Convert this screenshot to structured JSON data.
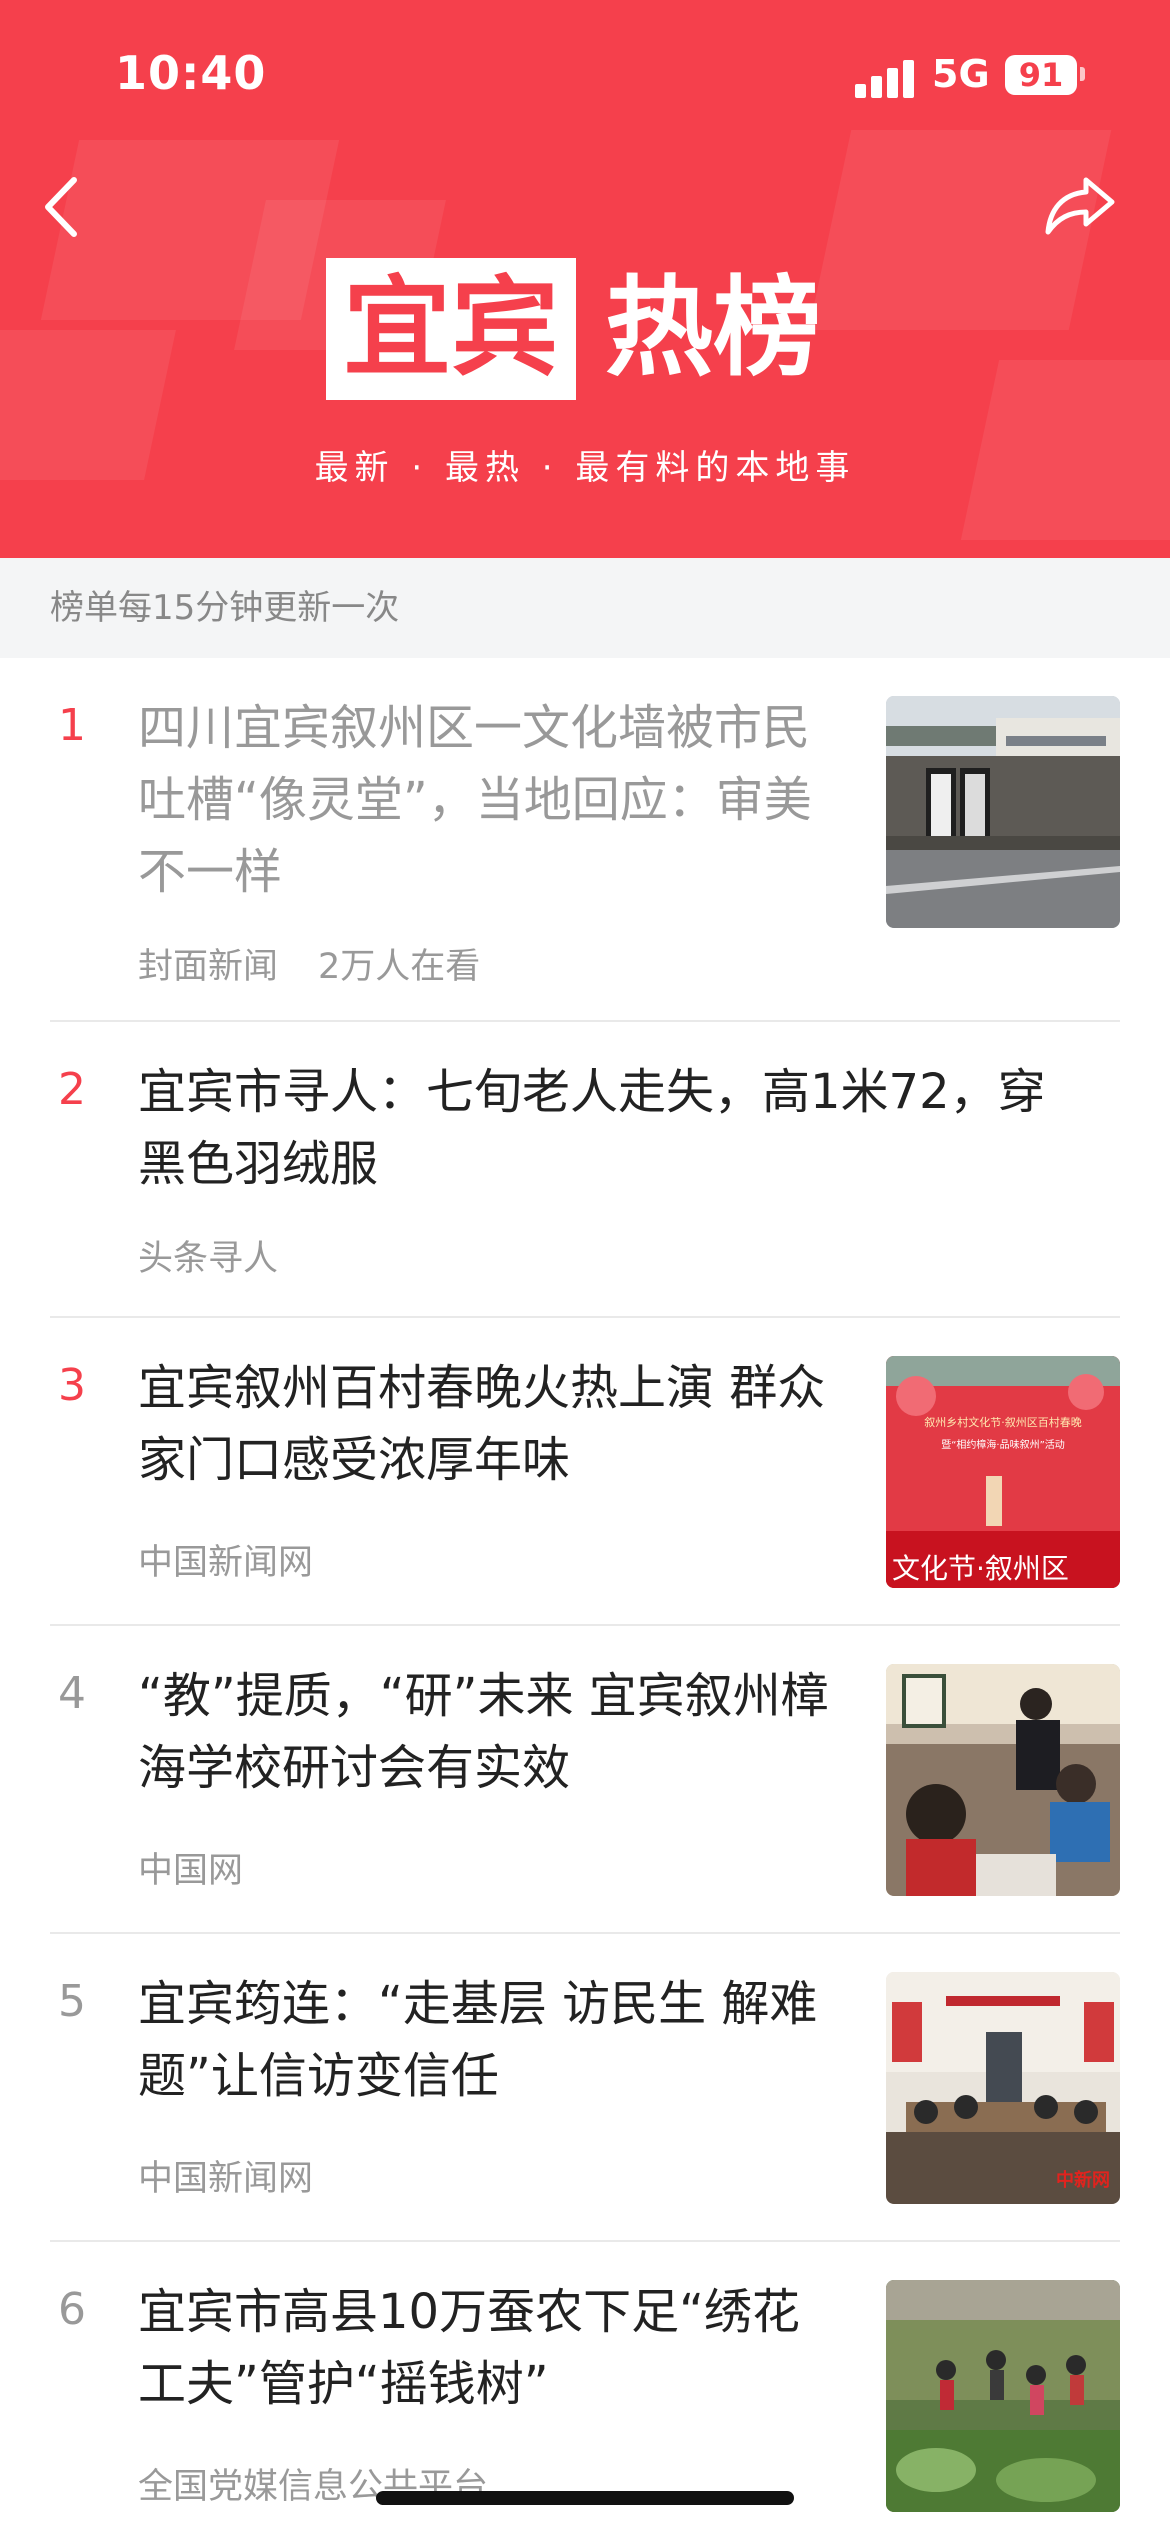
{
  "status_bar": {
    "time": "10:40",
    "network": "5G",
    "battery": "91"
  },
  "header": {
    "title_part1": "宜宾",
    "title_part2": "热榜",
    "tagline": "最新 · 最热 · 最有料的本地事"
  },
  "notice": "榜单每15分钟更新一次",
  "items": [
    {
      "rank": "1",
      "title": "四川宜宾叙州区一文化墙被市民吐槽“像灵堂”，当地回应：审美不一样",
      "source": "封面新闻",
      "views": "2万人在看",
      "read": true
    },
    {
      "rank": "2",
      "title": "宜宾市寻人：七旬老人走失，高1米72，穿黑色羽绒服",
      "source": "头条寻人",
      "views": "",
      "read": false
    },
    {
      "rank": "3",
      "title": "宜宾叙州百村春晚火热上演 群众家门口感受浓厚年味",
      "source": "中国新闻网",
      "views": "",
      "read": false
    },
    {
      "rank": "4",
      "title": "“教”提质，“研”未来 宜宾叙州樟海学校研讨会有实效",
      "source": "中国网",
      "views": "",
      "read": false
    },
    {
      "rank": "5",
      "title": "宜宾筠连：“走基层 访民生 解难题”让信访变信任",
      "source": "中国新闻网",
      "views": "",
      "read": false
    },
    {
      "rank": "6",
      "title": "宜宾市高县10万蚕农下足“绣花工夫”管护“摇钱树”",
      "source": "全国党媒信息公共平台",
      "views": "",
      "read": false
    }
  ],
  "thumb_overlays": {
    "item3_banner": "叙州乡村文化节·叙州区百村春晚",
    "item3_sub": "暨“相约樟海·品味叙州”活动",
    "item3_bottom": "文化节·叙州区",
    "item5_badge": "中新网"
  },
  "colors": {
    "brand": "#f5404c",
    "text": "#222222",
    "muted": "#999999"
  }
}
